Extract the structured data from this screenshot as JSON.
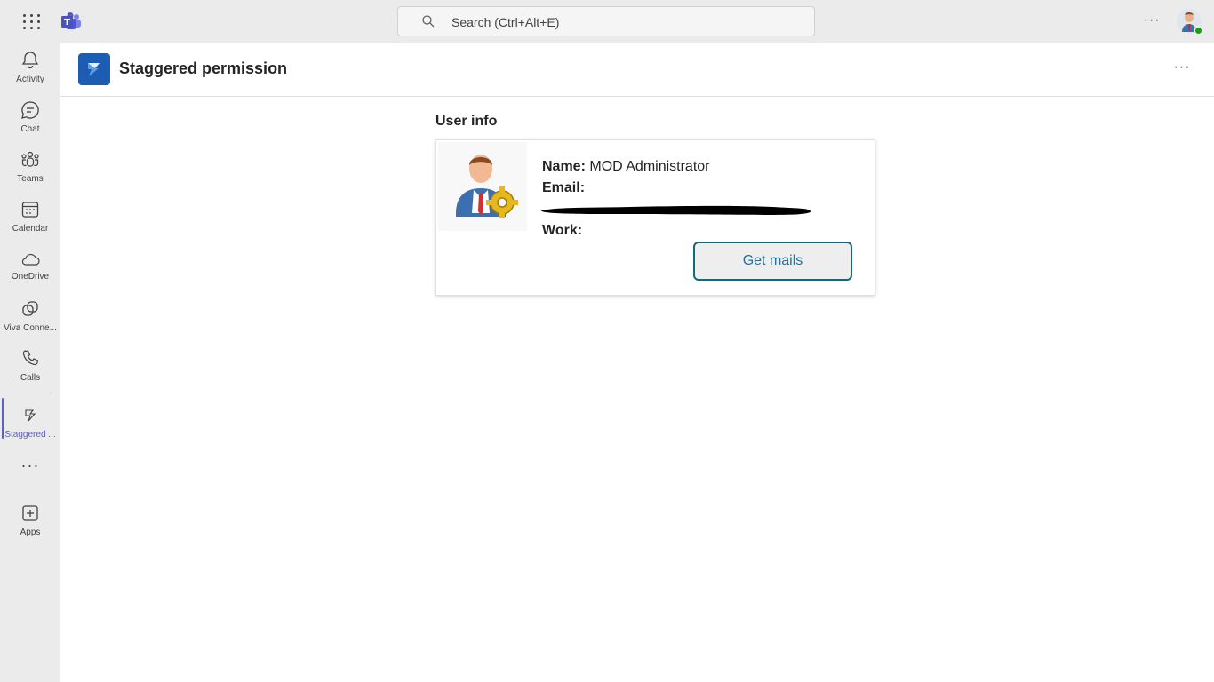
{
  "topbar": {
    "search_placeholder": "Search (Ctrl+Alt+E)",
    "more_label": "···"
  },
  "rail": {
    "items": [
      {
        "label": "Activity",
        "icon": "bell-icon"
      },
      {
        "label": "Chat",
        "icon": "chat-icon"
      },
      {
        "label": "Teams",
        "icon": "teams-icon"
      },
      {
        "label": "Calendar",
        "icon": "calendar-icon"
      },
      {
        "label": "OneDrive",
        "icon": "cloud-icon"
      },
      {
        "label": "Viva Conne...",
        "icon": "viva-connections-icon"
      },
      {
        "label": "Calls",
        "icon": "phone-icon"
      },
      {
        "label": "Staggered ...",
        "icon": "staggered-app-icon",
        "active": true
      },
      {
        "label": "Apps",
        "icon": "add-app-icon"
      }
    ],
    "more_label": "···"
  },
  "app": {
    "title": "Staggered permission",
    "more_label": "···"
  },
  "user_info": {
    "heading": "User info",
    "name_label": "Name:",
    "name_value": "MOD Administrator",
    "email_label": "Email:",
    "work_label": "Work:",
    "button_label": "Get mails"
  },
  "colors": {
    "accent": "#5b5fc7",
    "app_icon": "#1e5cb3",
    "button_border": "#116a76",
    "button_text": "#1774a8",
    "presence": "#13a10e"
  }
}
